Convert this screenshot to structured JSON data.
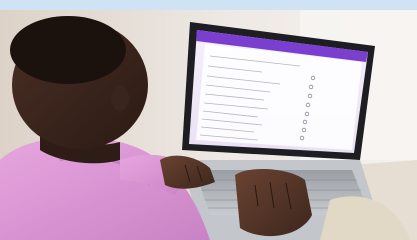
{
  "image": {
    "subject": "person-typing-on-laptop",
    "screen": {
      "header_color": "#7b3fd0",
      "form_background": "#efe8f7",
      "row_count": 10
    }
  }
}
